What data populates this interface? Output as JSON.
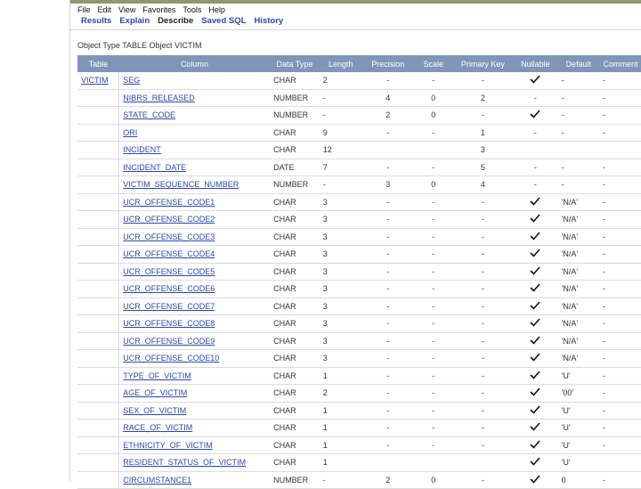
{
  "menu": [
    "File",
    "Edit",
    "View",
    "Favorites",
    "Tools",
    "Help"
  ],
  "tabs": [
    {
      "label": "Results",
      "active": false
    },
    {
      "label": "Explain",
      "active": false
    },
    {
      "label": "Describe",
      "active": true
    },
    {
      "label": "Saved SQL",
      "active": false
    },
    {
      "label": "History",
      "active": false
    }
  ],
  "object_info": "Object Type  TABLE Object  VICTIM",
  "headers": [
    "Table",
    "Column",
    "Data Type",
    "Length",
    "Precision",
    "Scale",
    "Primary Key",
    "Nullable",
    "Default",
    "Comment"
  ],
  "rows": [
    {
      "table": "VICTIM",
      "column": "SEG",
      "type": "CHAR",
      "length": "2",
      "precision": "-",
      "scale": "-",
      "pk": "-",
      "nullable": true,
      "default": "-",
      "comment": "-"
    },
    {
      "table": "",
      "column": "NIBRS_RELEASED",
      "type": "NUMBER",
      "length": "-",
      "precision": "4",
      "scale": "0",
      "pk": "2",
      "nullable": false,
      "default": "-",
      "comment": "-"
    },
    {
      "table": "",
      "column": "STATE_CODE",
      "type": "NUMBER",
      "length": "-",
      "precision": "2",
      "scale": "0",
      "pk": "-",
      "nullable": true,
      "default": "-",
      "comment": "-"
    },
    {
      "table": "",
      "column": "ORI",
      "type": "CHAR",
      "length": "9",
      "precision": "-",
      "scale": "-",
      "pk": "1",
      "nullable": false,
      "default": "-",
      "comment": "-"
    },
    {
      "table": "",
      "column": "INCIDENT",
      "type": "CHAR",
      "length": "12",
      "precision": "",
      "scale": "",
      "pk": "3",
      "nullable": false,
      "default": "",
      "comment": ""
    },
    {
      "table": "",
      "column": "INCIDENT_DATE",
      "type": "DATE",
      "length": "7",
      "precision": "-",
      "scale": "-",
      "pk": "5",
      "nullable": false,
      "default": "-",
      "comment": "-"
    },
    {
      "table": "",
      "column": "VICTIM_SEQUENCE_NUMBER",
      "type": "NUMBER",
      "length": "-",
      "precision": "3",
      "scale": "0",
      "pk": "4",
      "nullable": false,
      "default": "-",
      "comment": "-"
    },
    {
      "table": "",
      "column": "UCR_OFFENSE_CODE1",
      "type": "CHAR",
      "length": "3",
      "precision": "-",
      "scale": "-",
      "pk": "-",
      "nullable": true,
      "default": "'N/A'",
      "comment": "-"
    },
    {
      "table": "",
      "column": "UCR_OFFENSE_CODE2",
      "type": "CHAR",
      "length": "3",
      "precision": "-",
      "scale": "-",
      "pk": "-",
      "nullable": true,
      "default": "'N/A'",
      "comment": "-"
    },
    {
      "table": "",
      "column": "UCR_OFFENSE_CODE3",
      "type": "CHAR",
      "length": "3",
      "precision": "-",
      "scale": "-",
      "pk": "-",
      "nullable": true,
      "default": "'N/A'",
      "comment": "-"
    },
    {
      "table": "",
      "column": "UCR_OFFENSE_CODE4",
      "type": "CHAR",
      "length": "3",
      "precision": "-",
      "scale": "-",
      "pk": "-",
      "nullable": true,
      "default": "'N/A'",
      "comment": "-"
    },
    {
      "table": "",
      "column": "UCR_OFFENSE_CODE5",
      "type": "CHAR",
      "length": "3",
      "precision": "-",
      "scale": "-",
      "pk": "-",
      "nullable": true,
      "default": "'N/A'",
      "comment": "-"
    },
    {
      "table": "",
      "column": "UCR_OFFENSE_CODE6",
      "type": "CHAR",
      "length": "3",
      "precision": "-",
      "scale": "-",
      "pk": "-",
      "nullable": true,
      "default": "'N/A'",
      "comment": "-"
    },
    {
      "table": "",
      "column": "UCR_OFFENSE_CODE7",
      "type": "CHAR",
      "length": "3",
      "precision": "-",
      "scale": "-",
      "pk": "-",
      "nullable": true,
      "default": "'N/A'",
      "comment": "-"
    },
    {
      "table": "",
      "column": "UCR_OFFENSE_CODE8",
      "type": "CHAR",
      "length": "3",
      "precision": "-",
      "scale": "-",
      "pk": "-",
      "nullable": true,
      "default": "'N/A'",
      "comment": "-"
    },
    {
      "table": "",
      "column": "UCR_OFFENSE_CODE9",
      "type": "CHAR",
      "length": "3",
      "precision": "-",
      "scale": "-",
      "pk": "-",
      "nullable": true,
      "default": "'N/A'",
      "comment": "-"
    },
    {
      "table": "",
      "column": "UCR_OFFENSE_CODE10",
      "type": "CHAR",
      "length": "3",
      "precision": "-",
      "scale": "-",
      "pk": "-",
      "nullable": true,
      "default": "'N/A'",
      "comment": "-"
    },
    {
      "table": "",
      "column": "TYPE_OF_VICTIM",
      "type": "CHAR",
      "length": "1",
      "precision": "-",
      "scale": "-",
      "pk": "-",
      "nullable": true,
      "default": "'U'",
      "comment": "-"
    },
    {
      "table": "",
      "column": "AGE_OF_VICTIM",
      "type": "CHAR",
      "length": "2",
      "precision": "-",
      "scale": "-",
      "pk": "-",
      "nullable": true,
      "default": "'00'",
      "comment": "-"
    },
    {
      "table": "",
      "column": "SEX_OF_VICTIM",
      "type": "CHAR",
      "length": "1",
      "precision": "-",
      "scale": "-",
      "pk": "-",
      "nullable": true,
      "default": "'U'",
      "comment": "-"
    },
    {
      "table": "",
      "column": "RACE_OF_VICTIM",
      "type": "CHAR",
      "length": "1",
      "precision": "-",
      "scale": "-",
      "pk": "-",
      "nullable": true,
      "default": "'U'",
      "comment": "-"
    },
    {
      "table": "",
      "column": "ETHNICITY_OF_VICTIM",
      "type": "CHAR",
      "length": "1",
      "precision": "-",
      "scale": "-",
      "pk": "-",
      "nullable": true,
      "default": "'U'",
      "comment": "-"
    },
    {
      "table": "",
      "column": "RESIDENT_STATUS_OF_VICTIM",
      "type": "CHAR",
      "length": "1",
      "precision": "",
      "scale": "",
      "pk": "",
      "nullable": true,
      "default": "'U'",
      "comment": ""
    },
    {
      "table": "",
      "column": "CIRCUMSTANCE1",
      "type": "NUMBER",
      "length": "-",
      "precision": "2",
      "scale": "0",
      "pk": "-",
      "nullable": true,
      "default": "0",
      "comment": "-"
    }
  ],
  "colors": {
    "header_bg": "#7f96b8",
    "link": "#2b4aa8",
    "active_tab": "#222222"
  }
}
